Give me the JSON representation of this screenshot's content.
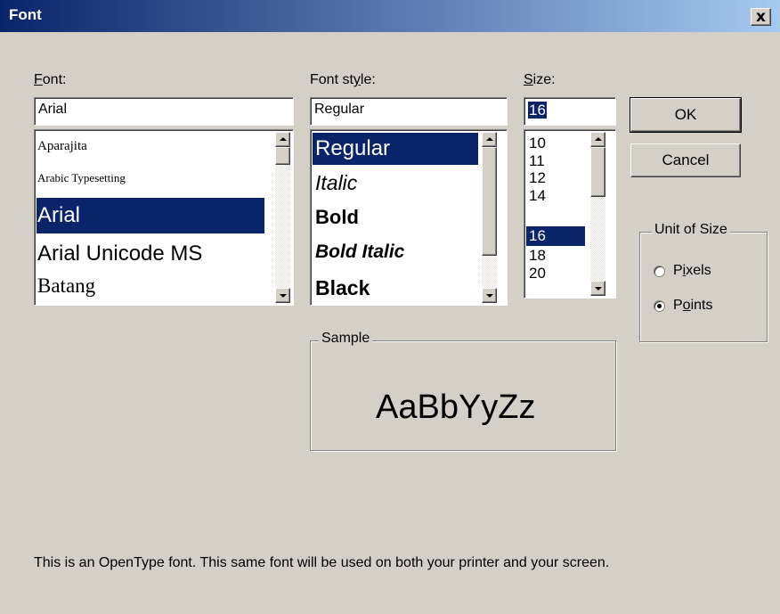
{
  "window": {
    "title": "Font",
    "close_label": "x"
  },
  "font": {
    "label_prefix": "",
    "label_ul": "F",
    "label_rest": "ont:",
    "value": "Arial",
    "items": [
      "Aparajita",
      "Arabic Typesetting",
      "Arial",
      "Arial Unicode MS",
      "Batang"
    ],
    "selected_index": 2
  },
  "style": {
    "label_prefix": "Font st",
    "label_ul": "y",
    "label_rest": "le:",
    "value": "Regular",
    "items": [
      "Regular",
      "Italic",
      "Bold",
      "Bold Italic",
      "Black"
    ],
    "selected_index": 0
  },
  "size": {
    "label_prefix": "",
    "label_ul": "S",
    "label_rest": "ize:",
    "value": "16",
    "items": [
      "10",
      "11",
      "12",
      "14",
      "16",
      "18",
      "20"
    ],
    "selected_index": 4
  },
  "buttons": {
    "ok": "OK",
    "cancel": "Cancel"
  },
  "unit": {
    "group_label": "Unit of Size",
    "pixels": {
      "prefix": "P",
      "ul": "i",
      "rest": "xels"
    },
    "points": {
      "prefix": "P",
      "ul": "o",
      "rest": "ints"
    },
    "selected": "Points"
  },
  "sample": {
    "group_label": "Sample",
    "text": "AaBbYyZz"
  },
  "info_text": "This is an OpenType font. This same font will be used on both your printer and your screen.",
  "colors": {
    "title_start": "#0a246a",
    "title_end": "#a6caf0",
    "selection": "#0a246a",
    "face": "#d4d0c8"
  },
  "icons": {
    "close": "close-icon",
    "scroll_up": "arrow-up-icon",
    "scroll_down": "arrow-down-icon"
  }
}
